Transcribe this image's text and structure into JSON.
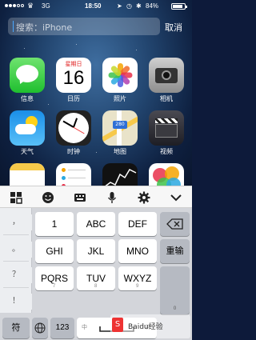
{
  "status_bar": {
    "carrier_icon": "crown-icon",
    "network": "3G",
    "time": "18:50",
    "battery_percent": "84%",
    "battery_level": 0.84
  },
  "search": {
    "placeholder": "搜索：iPhone",
    "cancel_label": "取消"
  },
  "apps": [
    {
      "label": "信息",
      "icon": "messages-icon"
    },
    {
      "label": "日历",
      "icon": "calendar-icon",
      "weekday": "星期日",
      "day": "16"
    },
    {
      "label": "照片",
      "icon": "photos-icon"
    },
    {
      "label": "相机",
      "icon": "camera-icon"
    },
    {
      "label": "天气",
      "icon": "weather-icon"
    },
    {
      "label": "时钟",
      "icon": "clock-icon"
    },
    {
      "label": "地图",
      "icon": "maps-icon",
      "shield": "280"
    },
    {
      "label": "视频",
      "icon": "videos-icon"
    },
    {
      "label": "",
      "icon": "notes-icon"
    },
    {
      "label": "",
      "icon": "reminders-icon"
    },
    {
      "label": "",
      "icon": "stocks-icon"
    },
    {
      "label": "",
      "icon": "game-center-icon"
    }
  ],
  "keyboard_toolbar": [
    "grid-icon",
    "emoji-icon",
    "keyboard-icon",
    "microphone-icon",
    "gear-icon",
    "chevron-down-icon"
  ],
  "keyboard": {
    "side_keys": [
      "，",
      "。",
      "？",
      "！"
    ],
    "keys": [
      {
        "main": "1",
        "sub": ""
      },
      {
        "main": "ABC",
        "sub": ""
      },
      {
        "main": "DEF",
        "sub": ""
      },
      {
        "main": "GHI",
        "sub": ""
      },
      {
        "main": "JKL",
        "sub": ""
      },
      {
        "main": "MNO",
        "sub": ""
      },
      {
        "main": "PQRS",
        "sub": "7"
      },
      {
        "main": "TUV",
        "sub": "8"
      },
      {
        "main": "WXYZ",
        "sub": "9"
      }
    ],
    "delete_icon": "backspace-icon",
    "retype_label": "重输",
    "zero_label": "0",
    "symbol_label": "符",
    "globe_icon": "globe-icon",
    "num_label": "123",
    "lang_left": "中",
    "lang_right": "中",
    "space_icon": "space-bar-icon",
    "watermark_text": "Baidu经验"
  },
  "colors": {
    "accent": "#4aa8ff",
    "keyboard_bg": "#d3d5da"
  }
}
